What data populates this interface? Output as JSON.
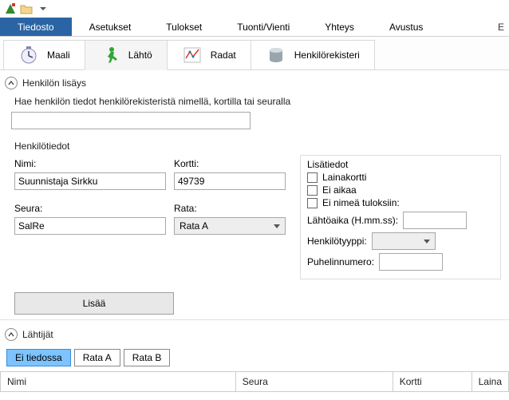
{
  "menubar": {
    "file": "Tiedosto",
    "settings": "Asetukset",
    "results": "Tulokset",
    "import_export": "Tuonti/Vienti",
    "connection": "Yhteys",
    "help": "Avustus",
    "right_char": "E"
  },
  "ribbon": {
    "finish": "Maali",
    "start": "Lähtö",
    "courses": "Radat",
    "registry": "Henkilörekisteri"
  },
  "add_person": {
    "section_title": "Henkilön lisäys",
    "help_text": "Hae henkilön tiedot henkilörekisteristä nimellä, kortilla tai seuralla",
    "search_value": "",
    "details_header": "Henkilötiedot",
    "name_label": "Nimi:",
    "name_value": "Suunnistaja Sirkku",
    "card_label": "Kortti:",
    "card_value": "49739",
    "club_label": "Seura:",
    "club_value": "SalRe",
    "course_label": "Rata:",
    "course_value": "Rata A",
    "extra_header": "Lisätiedot",
    "rental_card": "Lainakortti",
    "no_time": "Ei aikaa",
    "no_name_results": "Ei nimeä tuloksiin:",
    "start_time_label": "Lähtöaika (H.mm.ss):",
    "start_time_value": "",
    "person_type_label": "Henkilötyyppi:",
    "person_type_value": "",
    "phone_label": "Puhelinnumero:",
    "phone_value": "",
    "add_button": "Lisää"
  },
  "starters": {
    "section_title": "Lähtijät",
    "tabs": {
      "unknown": "Ei tiedossa",
      "a": "Rata A",
      "b": "Rata B"
    },
    "columns": {
      "name": "Nimi",
      "club": "Seura",
      "card": "Kortti",
      "rent": "Laina"
    }
  }
}
